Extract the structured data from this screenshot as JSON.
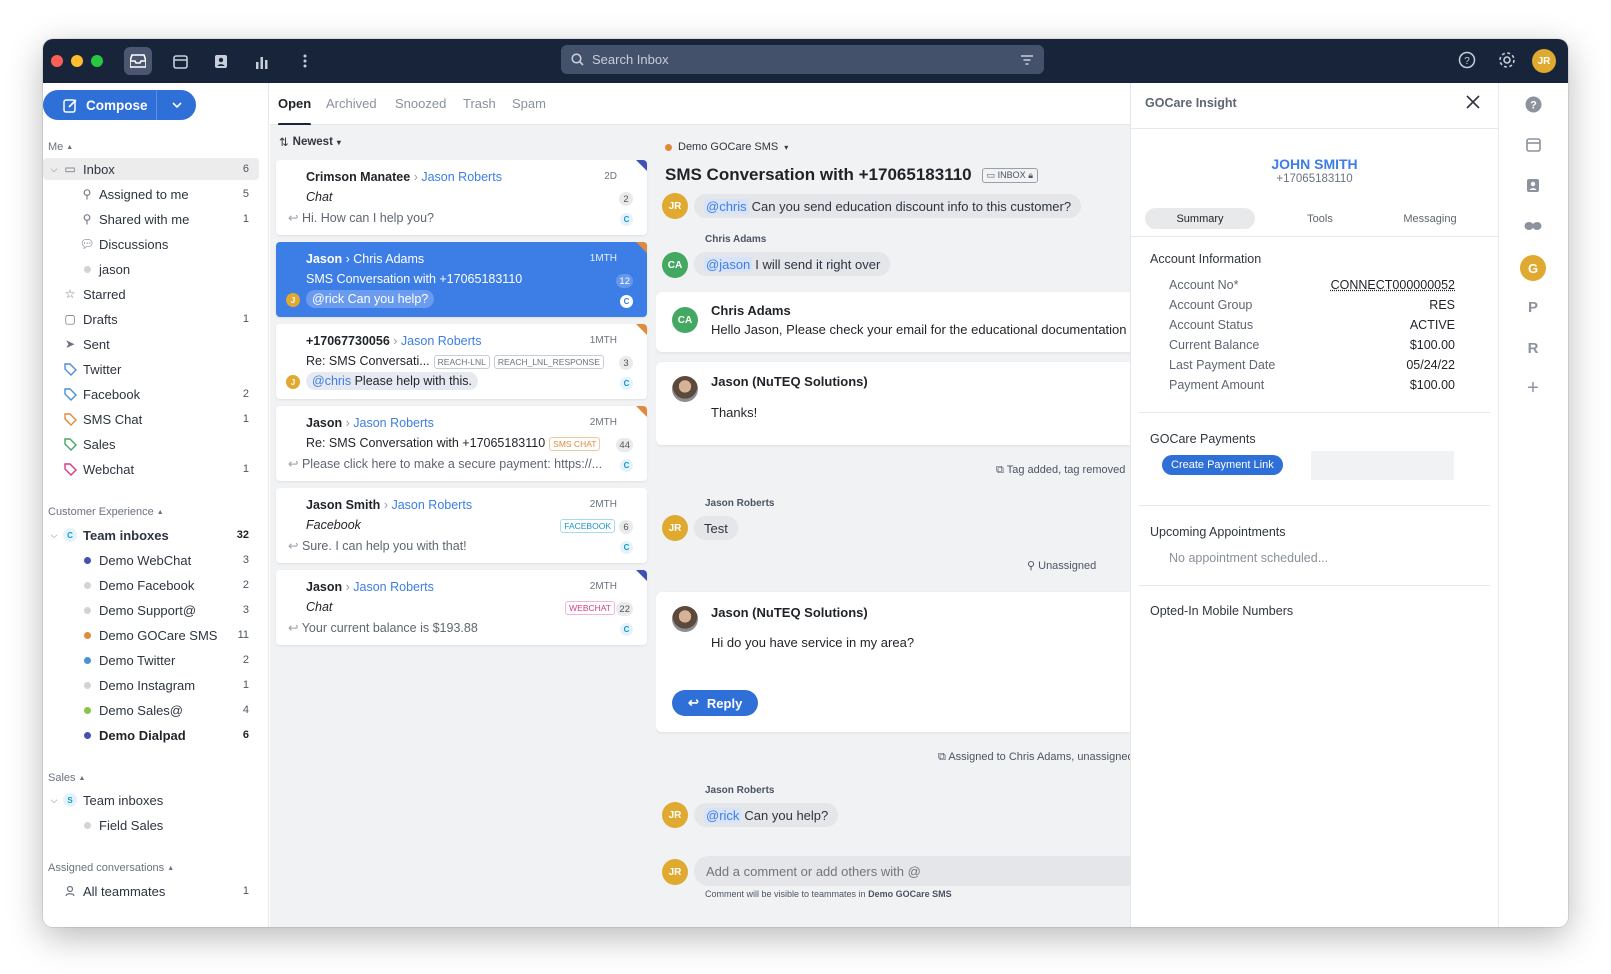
{
  "topbar": {
    "search_placeholder": "Search Inbox"
  },
  "user": {
    "initials": "JR"
  },
  "compose": {
    "label": "Compose"
  },
  "sidebar": {
    "me_label": "Me",
    "me_items": [
      {
        "label": "Inbox",
        "count": "6"
      },
      {
        "label": "Assigned to me",
        "count": "5"
      },
      {
        "label": "Shared with me",
        "count": "1"
      },
      {
        "label": "Discussions",
        "count": ""
      },
      {
        "label": "jason",
        "count": ""
      },
      {
        "label": "Starred",
        "count": ""
      },
      {
        "label": "Drafts",
        "count": "1"
      },
      {
        "label": "Sent",
        "count": ""
      },
      {
        "label": "Twitter",
        "count": ""
      },
      {
        "label": "Facebook",
        "count": "2"
      },
      {
        "label": "SMS Chat",
        "count": "1"
      },
      {
        "label": "Sales",
        "count": ""
      },
      {
        "label": "Webchat",
        "count": "1"
      }
    ],
    "cx_label": "Customer Experience",
    "team_inboxes_label": "Team inboxes",
    "team_inboxes_count": "32",
    "team_badge": "C",
    "cx_items": [
      {
        "label": "Demo WebChat",
        "count": "3",
        "color": "#3f51b5"
      },
      {
        "label": "Demo Facebook",
        "count": "2",
        "color": "#d0d3d8"
      },
      {
        "label": "Demo Support@",
        "count": "3",
        "color": "#d0d3d8"
      },
      {
        "label": "Demo GOCare SMS",
        "count": "11",
        "color": "#e08a3c"
      },
      {
        "label": "Demo Twitter",
        "count": "2",
        "color": "#4a90d9"
      },
      {
        "label": "Demo Instagram",
        "count": "1",
        "color": "#d0d3d8"
      },
      {
        "label": "Demo Sales@",
        "count": "4",
        "color": "#8bc34a"
      },
      {
        "label": "Demo Dialpad",
        "count": "6",
        "color": "#3f51b5"
      }
    ],
    "sales_label": "Sales",
    "sales_team_label": "Team inboxes",
    "sales_badge": "S",
    "field_sales": "Field Sales",
    "assigned_label": "Assigned conversations",
    "all_teammates": "All teammates",
    "all_teammates_count": "1"
  },
  "tabs": [
    "Open",
    "Archived",
    "Snoozed",
    "Trash",
    "Spam"
  ],
  "sort": {
    "label": "Newest"
  },
  "conversations": [
    {
      "from": "Crimson Manatee",
      "to": "Jason Roberts",
      "age": "2D",
      "subject": "Chat",
      "preview": "Hi. How can I help you?",
      "badge": "2",
      "c": "C"
    },
    {
      "from": "Jason",
      "to": "Chris Adams",
      "age": "1MTH",
      "subject": "SMS Conversation with +17065183110",
      "mention": "@rick",
      "preview": "Can you help?",
      "badge": "12",
      "c": "C"
    },
    {
      "from": "+17067730056",
      "to": "Jason Roberts",
      "age": "1MTH",
      "subject": "Re: SMS Conversati...",
      "tag1": "REACH-LNL",
      "tag2": "REACH_LNL_RESPONSE",
      "mention": "@chris",
      "preview": "Please help with this.",
      "badge": "3",
      "c": "C"
    },
    {
      "from": "Jason",
      "to": "Jason Roberts",
      "age": "2MTH",
      "subject": "Re: SMS Conversation with +17065183110",
      "tag": "SMS CHAT",
      "preview": "Please click here to make a secure payment: https://...",
      "badge": "44",
      "c": "C"
    },
    {
      "from": "Jason Smith",
      "to": "Jason Roberts",
      "age": "2MTH",
      "subject": "Facebook",
      "tag": "FACEBOOK",
      "preview": "Sure. I can help you with that!",
      "badge": "6",
      "c": "C"
    },
    {
      "from": "Jason",
      "to": "Jason Roberts",
      "age": "2MTH",
      "subject": "Chat",
      "tag": "WEBCHAT",
      "preview": "Your current balance is $193.88",
      "badge": "22",
      "c": "C"
    }
  ],
  "thread": {
    "inbox_name": "Demo GOCare SMS",
    "title": "SMS Conversation with +17065183110",
    "inbox_tag": "INBOX",
    "m1": {
      "initials": "JR",
      "mention": "@chris",
      "text": "Can you send education discount info to this customer?"
    },
    "m2": {
      "author": "Chris Adams",
      "initials": "CA",
      "mention": "@jason",
      "text": "I will send it right over"
    },
    "m3": {
      "author": "Chris Adams",
      "initials": "CA",
      "text": "Hello Jason, Please check your email for the educational documentation"
    },
    "m4": {
      "author": "Jason (NuTEQ Solutions)",
      "text": "Thanks!"
    },
    "event1": "Tag added, tag removed",
    "m5": {
      "author": "Jason Roberts",
      "initials": "JR",
      "text": "Test"
    },
    "event2": "Unassigned",
    "m6": {
      "author": "Jason (NuTEQ Solutions)",
      "text": "Hi do you have service in my area?"
    },
    "reply": "Reply",
    "event3": "Assigned to Chris Adams, unassigned",
    "m7": {
      "author": "Jason Roberts",
      "initials": "JR",
      "mention": "@rick",
      "text": "Can you help?"
    },
    "comment_placeholder": "Add a comment or add others with @",
    "comment_note": "Comment will be visible to teammates in",
    "comment_note_inbox": "Demo GOCare SMS"
  },
  "insight": {
    "title": "GOCare Insight",
    "name": "JOHN SMITH",
    "phone": "+17065183110",
    "tabs": [
      "Summary",
      "Tools",
      "Messaging"
    ],
    "account_heading": "Account Information",
    "account_rows": [
      {
        "label": "Account No*",
        "value": "CONNECT000000052"
      },
      {
        "label": "Account Group",
        "value": "RES"
      },
      {
        "label": "Account Status",
        "value": "ACTIVE"
      },
      {
        "label": "Current Balance",
        "value": "$100.00"
      },
      {
        "label": "Last Payment Date",
        "value": "05/24/22"
      },
      {
        "label": "Payment Amount",
        "value": "$100.00"
      }
    ],
    "payments_heading": "GOCare Payments",
    "payment_button": "Create Payment Link",
    "appointments_heading": "Upcoming Appointments",
    "appointments_empty": "No appointment scheduled...",
    "mobile_heading": "Opted-In Mobile Numbers"
  },
  "rail": {
    "g": "G",
    "p": "P",
    "r": "R"
  },
  "colors": {
    "primary": "#2f6fd8",
    "topbar": "#17243a",
    "accent": "#3c7ee6"
  }
}
